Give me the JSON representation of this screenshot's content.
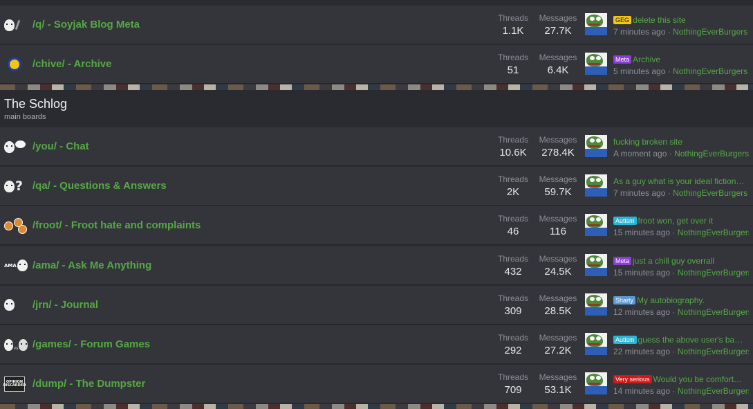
{
  "labels": {
    "threads": "Threads",
    "messages": "Messages"
  },
  "top_rows": [
    {
      "icon": "soyjak-icon",
      "title": "/q/ - Soyjak Blog Meta",
      "threads": "1.1K",
      "messages": "27.7K",
      "badge": "GEG",
      "badge_color": "#f5c518",
      "badge_text_color": "#222",
      "thread_title": "delete this site",
      "time": "7 minutes ago",
      "sep": "·",
      "user": "NothingEverBurgers"
    },
    {
      "icon": "archive-medal-icon",
      "title": "/chive/ - Archive",
      "threads": "51",
      "messages": "6.4K",
      "badge": "Meta",
      "badge_color": "#8a3fd1",
      "badge_text_color": "#fff",
      "thread_title": "Archive",
      "time": "5 minutes ago",
      "sep": "·",
      "user": "NothingEverBurgers"
    }
  ],
  "section": {
    "name": "The Schlog",
    "description": "main boards"
  },
  "rows": [
    {
      "icon": "chat-bubble-icon",
      "title": "/you/ - Chat",
      "threads": "10.6K",
      "messages": "278.4K",
      "badge": "",
      "badge_color": "",
      "badge_text_color": "",
      "thread_title": "fucking broken site",
      "time": "A moment ago",
      "sep": "·",
      "user": "NothingEverBurgers"
    },
    {
      "icon": "question-mark-icon",
      "title": "/qa/ - Questions & Answers",
      "threads": "2K",
      "messages": "59.7K",
      "badge": "",
      "badge_color": "",
      "badge_text_color": "",
      "thread_title": "As a guy what is your ideal fiction…",
      "time": "7 minutes ago",
      "sep": "·",
      "user": "NothingEverBurgers"
    },
    {
      "icon": "orange-soyjak-icon",
      "title": "/froot/ - Froot hate and complaints",
      "threads": "46",
      "messages": "116",
      "badge": "Autism",
      "badge_color": "#29b6d6",
      "badge_text_color": "#fff",
      "thread_title": "froot won, get over it",
      "time": "15 minutes ago",
      "sep": "·",
      "user": "NothingEverBurgers"
    },
    {
      "icon": "ama-icon",
      "title": "/ama/ - Ask Me Anything",
      "threads": "432",
      "messages": "24.5K",
      "badge": "Meta",
      "badge_color": "#8a3fd1",
      "badge_text_color": "#fff",
      "thread_title": "just a chill guy overrall",
      "time": "15 minutes ago",
      "sep": "·",
      "user": "NothingEverBurgers"
    },
    {
      "icon": "journal-icon",
      "title": "/jrn/ - Journal",
      "threads": "309",
      "messages": "28.5K",
      "badge": "Sharty",
      "badge_color": "#5b9bd5",
      "badge_text_color": "#fff",
      "thread_title": "My autobiography.",
      "time": "12 minutes ago",
      "sep": "·",
      "user": "NothingEverBurgers"
    },
    {
      "icon": "versus-icon",
      "title": "/games/ - Forum Games",
      "threads": "292",
      "messages": "27.2K",
      "badge": "Autism",
      "badge_color": "#29b6d6",
      "badge_text_color": "#fff",
      "thread_title": "guess the above user's ba…",
      "time": "22 minutes ago",
      "sep": "·",
      "user": "NothingEverBurgers"
    },
    {
      "icon": "dumpster-icon",
      "title": "/dump/ - The Dumpster",
      "threads": "709",
      "messages": "53.1K",
      "badge": "Very serious",
      "badge_color": "#d01818",
      "badge_text_color": "#fff",
      "thread_title": "Would you be comfort…",
      "time": "14 minutes ago",
      "sep": "·",
      "user": "NothingEverBurgers"
    }
  ],
  "dump_icon_text": "OPINION DISCARDED"
}
